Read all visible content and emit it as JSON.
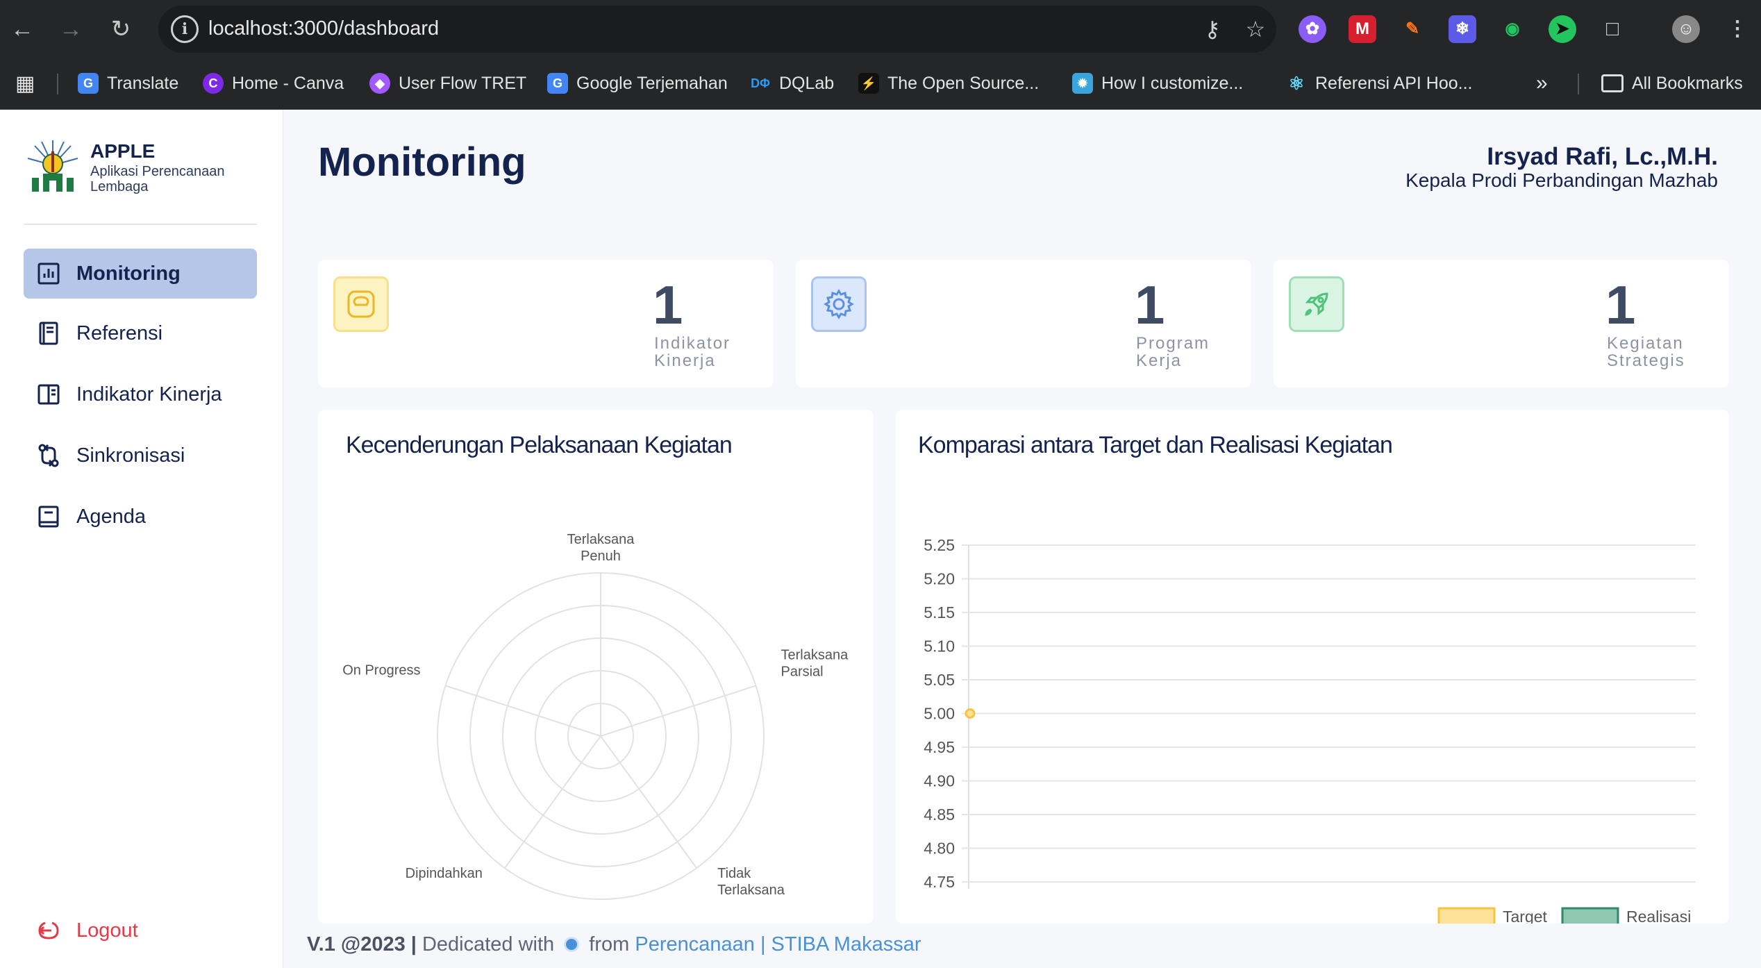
{
  "browser": {
    "url": "localhost:3000/dashboard",
    "bookmarks": [
      {
        "label": "Translate",
        "icon": "google-translate-icon",
        "color": "#4285f4"
      },
      {
        "label": "Home - Canva",
        "icon": "canva-icon",
        "color": "#7d2ae8"
      },
      {
        "label": "User Flow TRET",
        "icon": "figma-icon",
        "color": "#a259ff"
      },
      {
        "label": "Google Terjemahan",
        "icon": "google-translate-icon",
        "color": "#4285f4"
      },
      {
        "label": "DQLab",
        "icon": "dqlab-icon",
        "color": "#2b7bd6"
      },
      {
        "label": "The Open Source...",
        "icon": "opensource-icon",
        "color": "#1d1d1d"
      },
      {
        "label": "How I customize...",
        "icon": "medium-icon",
        "color": "#39a5dc"
      },
      {
        "label": "Referensi API Hoo...",
        "icon": "react-icon",
        "color": "#61dafb"
      }
    ],
    "all_bookmarks": "All Bookmarks"
  },
  "sidebar": {
    "brand_title": "APPLE",
    "brand_subtitle": "Aplikasi Perencanaan Lembaga",
    "items": [
      {
        "label": "Monitoring",
        "icon": "bar-chart-icon",
        "active": true
      },
      {
        "label": "Referensi",
        "icon": "book-icon",
        "active": false
      },
      {
        "label": "Indikator Kinerja",
        "icon": "open-book-icon",
        "active": false
      },
      {
        "label": "Sinkronisasi",
        "icon": "sync-icon",
        "active": false
      },
      {
        "label": "Agenda",
        "icon": "calendar-book-icon",
        "active": false
      }
    ],
    "logout": "Logout"
  },
  "header": {
    "title": "Monitoring",
    "user_name": "Irsyad Rafi, Lc.,M.H.",
    "user_role": "Kepala Prodi Perbandingan Mazhab"
  },
  "stats": [
    {
      "value": "1",
      "label": "Indikator Kinerja",
      "icon": "scale-icon",
      "color": "#f5c542"
    },
    {
      "value": "1",
      "label": "Program Kerja",
      "icon": "gear-icon",
      "color": "#5b8fe0"
    },
    {
      "value": "1",
      "label": "Kegiatan Strategis",
      "icon": "rocket-icon",
      "color": "#4fc27a"
    }
  ],
  "chart_data": [
    {
      "type": "radar",
      "title": "Kecenderungan Pelaksanaan Kegiatan",
      "axes": [
        "Terlaksana Penuh",
        "Terlaksana Parsial",
        "Tidak Terlaksana",
        "Dipindahkan",
        "On Progress"
      ],
      "axis_labels": [
        [
          "Terlaksana",
          "Penuh"
        ],
        [
          "Terlaksana",
          "Parsial"
        ],
        [
          "Tidak",
          "Terlaksana"
        ],
        [
          "Dipindahkan"
        ],
        [
          "On Progress"
        ]
      ],
      "rings": 5,
      "series": []
    },
    {
      "type": "line",
      "title": "Komparasi antara Target dan Realisasi Kegiatan",
      "ylim": [
        4.75,
        5.25
      ],
      "yticks": [
        "5.25",
        "5.20",
        "5.15",
        "5.10",
        "5.05",
        "5.00",
        "4.95",
        "4.90",
        "4.85",
        "4.80",
        "4.75"
      ],
      "grid": true,
      "legend": "bottom-right",
      "series": [
        {
          "name": "Target",
          "color": "#f5c542",
          "fill": "#fbe19a",
          "values": [
            5.0
          ]
        },
        {
          "name": "Realisasi",
          "color": "#2e8b6a",
          "fill": "#8fc7b0",
          "values": []
        }
      ]
    }
  ],
  "footer": {
    "version": "V.1 @2023 |",
    "text1": "Dedicated with",
    "text2": "from",
    "link": "Perencanaan | STIBA Makassar"
  }
}
